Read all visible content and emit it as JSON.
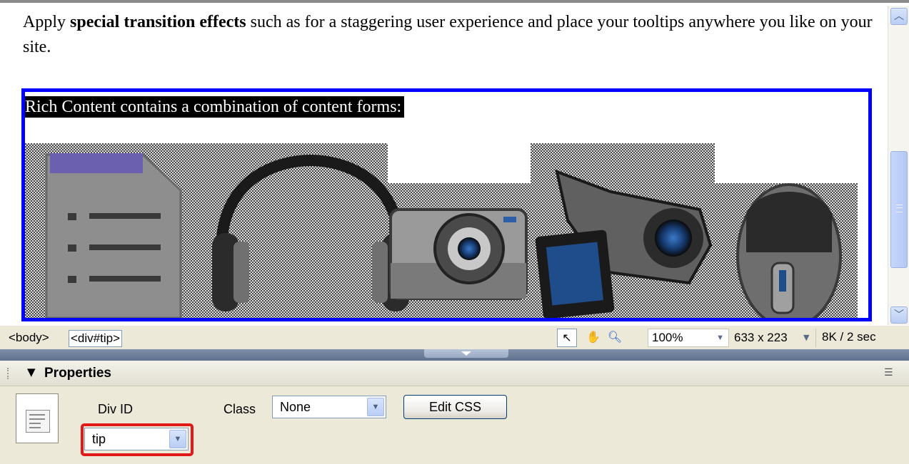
{
  "document": {
    "intro_before": "Apply ",
    "intro_bold": "special transition effects",
    "intro_after": " such as for a staggering user experience and place your tooltips anywhere you like on your site.",
    "tip_text": "Rich Content contains a combination of content forms:"
  },
  "icons": [
    "document-icon",
    "headphones-icon",
    "camera-icon",
    "camcorder-icon",
    "mouse-icon"
  ],
  "status_bar": {
    "tag_body": "<body>",
    "tag_div": "<div#tip>",
    "zoom": "100%",
    "dimensions": "633 x 223",
    "size_time": "8K / 2 sec"
  },
  "properties": {
    "title": "Properties",
    "div_id_label": "Div ID",
    "div_id_value": "tip",
    "class_label": "Class",
    "class_value": "None",
    "edit_css_label": "Edit CSS"
  },
  "colors": {
    "selection_border": "#0000ff",
    "highlight_box": "#e01919"
  }
}
